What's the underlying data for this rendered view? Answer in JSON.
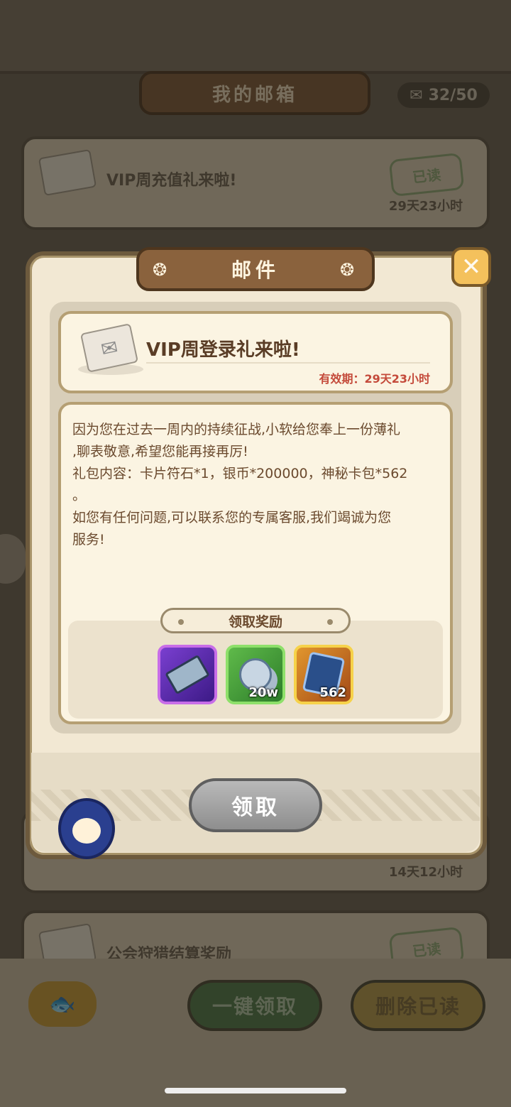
{
  "background": {
    "mailbox_title": "我的邮箱",
    "mail_count": "32/50",
    "mails": [
      {
        "title": "VIP周充值礼来啦!",
        "status": "已读",
        "time": "29天23小时"
      },
      {
        "title": "",
        "status": "",
        "time": "14天12小时"
      },
      {
        "title": "公会狩猎结算奖励",
        "status": "已读",
        "time": ""
      }
    ],
    "buttons": {
      "claim_all": "一键领取",
      "delete_read": "删除已读"
    }
  },
  "modal": {
    "title": "邮件",
    "subject": "VIP周登录礼来啦!",
    "validity": "有效期：29天23小时",
    "body_lines": [
      "因为您在过去一周内的持续征战,小软给您奉上一份薄礼",
      ",聊表敬意,希望您能再接再厉!",
      "礼包内容：卡片符石*1，银币*200000，神秘卡包*562",
      "。",
      "如您有任何问题,可以联系您的专属客服,我们竭诚为您",
      "服务!"
    ],
    "reward_label": "领取奖励",
    "rewards": [
      {
        "icon": "rune-stone-icon",
        "qty": ""
      },
      {
        "icon": "silver-coin-icon",
        "qty": "20w"
      },
      {
        "icon": "card-pack-icon",
        "qty": "562"
      }
    ],
    "claim_button": "领取"
  }
}
